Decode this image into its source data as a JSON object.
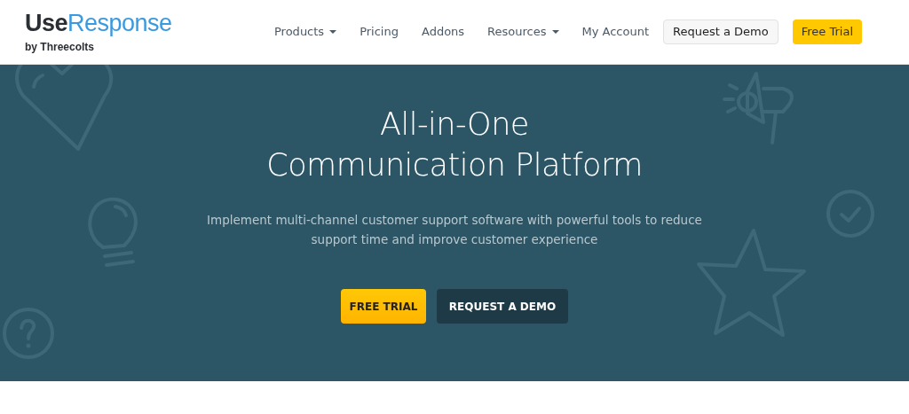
{
  "logo": {
    "dark": "Use",
    "accent": "Response",
    "tagline": "by Threecolts"
  },
  "nav": [
    {
      "label": "Products",
      "has_menu": true
    },
    {
      "label": "Pricing",
      "has_menu": false
    },
    {
      "label": "Addons",
      "has_menu": false
    },
    {
      "label": "Resources",
      "has_menu": true
    },
    {
      "label": "My Account",
      "has_menu": false
    }
  ],
  "header_buttons": [
    {
      "label": "Request a Demo",
      "kind": "light"
    },
    {
      "label": "Free Trial",
      "kind": "yellow"
    }
  ],
  "hero": {
    "title_lines": [
      "All-in-One",
      "Communication Platform"
    ],
    "subtitle": "Implement multi-channel customer support software with powerful tools to reduce support time and improve customer experience",
    "buttons": [
      {
        "label": "FREE TRIAL",
        "kind": "yellow"
      },
      {
        "label": "REQUEST A DEMO",
        "kind": "dark"
      }
    ]
  }
}
